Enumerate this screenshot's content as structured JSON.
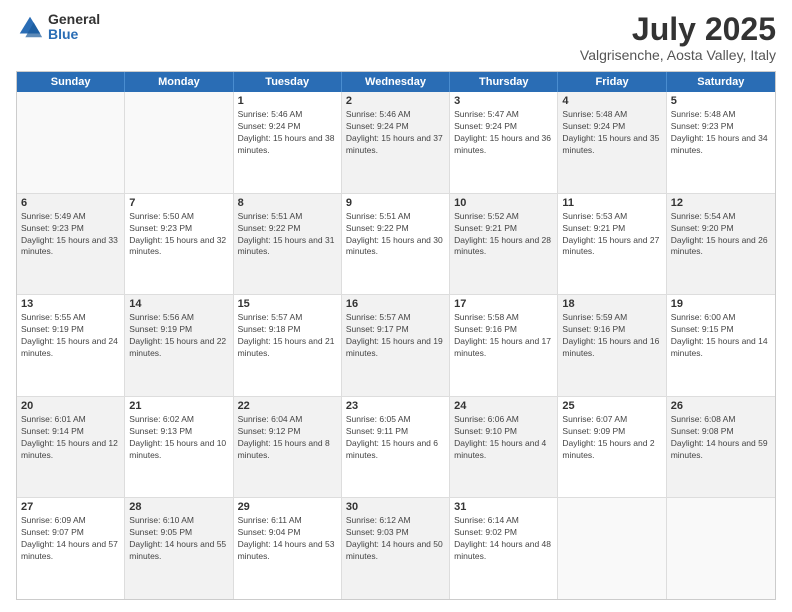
{
  "logo": {
    "general": "General",
    "blue": "Blue"
  },
  "title": "July 2025",
  "subtitle": "Valgrisenche, Aosta Valley, Italy",
  "days": [
    "Sunday",
    "Monday",
    "Tuesday",
    "Wednesday",
    "Thursday",
    "Friday",
    "Saturday"
  ],
  "weeks": [
    [
      {
        "day": "",
        "sunrise": "",
        "sunset": "",
        "daylight": "",
        "shaded": false,
        "empty": true
      },
      {
        "day": "",
        "sunrise": "",
        "sunset": "",
        "daylight": "",
        "shaded": false,
        "empty": true
      },
      {
        "day": "1",
        "sunrise": "Sunrise: 5:46 AM",
        "sunset": "Sunset: 9:24 PM",
        "daylight": "Daylight: 15 hours and 38 minutes.",
        "shaded": false,
        "empty": false
      },
      {
        "day": "2",
        "sunrise": "Sunrise: 5:46 AM",
        "sunset": "Sunset: 9:24 PM",
        "daylight": "Daylight: 15 hours and 37 minutes.",
        "shaded": true,
        "empty": false
      },
      {
        "day": "3",
        "sunrise": "Sunrise: 5:47 AM",
        "sunset": "Sunset: 9:24 PM",
        "daylight": "Daylight: 15 hours and 36 minutes.",
        "shaded": false,
        "empty": false
      },
      {
        "day": "4",
        "sunrise": "Sunrise: 5:48 AM",
        "sunset": "Sunset: 9:24 PM",
        "daylight": "Daylight: 15 hours and 35 minutes.",
        "shaded": true,
        "empty": false
      },
      {
        "day": "5",
        "sunrise": "Sunrise: 5:48 AM",
        "sunset": "Sunset: 9:23 PM",
        "daylight": "Daylight: 15 hours and 34 minutes.",
        "shaded": false,
        "empty": false
      }
    ],
    [
      {
        "day": "6",
        "sunrise": "Sunrise: 5:49 AM",
        "sunset": "Sunset: 9:23 PM",
        "daylight": "Daylight: 15 hours and 33 minutes.",
        "shaded": true,
        "empty": false
      },
      {
        "day": "7",
        "sunrise": "Sunrise: 5:50 AM",
        "sunset": "Sunset: 9:23 PM",
        "daylight": "Daylight: 15 hours and 32 minutes.",
        "shaded": false,
        "empty": false
      },
      {
        "day": "8",
        "sunrise": "Sunrise: 5:51 AM",
        "sunset": "Sunset: 9:22 PM",
        "daylight": "Daylight: 15 hours and 31 minutes.",
        "shaded": true,
        "empty": false
      },
      {
        "day": "9",
        "sunrise": "Sunrise: 5:51 AM",
        "sunset": "Sunset: 9:22 PM",
        "daylight": "Daylight: 15 hours and 30 minutes.",
        "shaded": false,
        "empty": false
      },
      {
        "day": "10",
        "sunrise": "Sunrise: 5:52 AM",
        "sunset": "Sunset: 9:21 PM",
        "daylight": "Daylight: 15 hours and 28 minutes.",
        "shaded": true,
        "empty": false
      },
      {
        "day": "11",
        "sunrise": "Sunrise: 5:53 AM",
        "sunset": "Sunset: 9:21 PM",
        "daylight": "Daylight: 15 hours and 27 minutes.",
        "shaded": false,
        "empty": false
      },
      {
        "day": "12",
        "sunrise": "Sunrise: 5:54 AM",
        "sunset": "Sunset: 9:20 PM",
        "daylight": "Daylight: 15 hours and 26 minutes.",
        "shaded": true,
        "empty": false
      }
    ],
    [
      {
        "day": "13",
        "sunrise": "Sunrise: 5:55 AM",
        "sunset": "Sunset: 9:19 PM",
        "daylight": "Daylight: 15 hours and 24 minutes.",
        "shaded": false,
        "empty": false
      },
      {
        "day": "14",
        "sunrise": "Sunrise: 5:56 AM",
        "sunset": "Sunset: 9:19 PM",
        "daylight": "Daylight: 15 hours and 22 minutes.",
        "shaded": true,
        "empty": false
      },
      {
        "day": "15",
        "sunrise": "Sunrise: 5:57 AM",
        "sunset": "Sunset: 9:18 PM",
        "daylight": "Daylight: 15 hours and 21 minutes.",
        "shaded": false,
        "empty": false
      },
      {
        "day": "16",
        "sunrise": "Sunrise: 5:57 AM",
        "sunset": "Sunset: 9:17 PM",
        "daylight": "Daylight: 15 hours and 19 minutes.",
        "shaded": true,
        "empty": false
      },
      {
        "day": "17",
        "sunrise": "Sunrise: 5:58 AM",
        "sunset": "Sunset: 9:16 PM",
        "daylight": "Daylight: 15 hours and 17 minutes.",
        "shaded": false,
        "empty": false
      },
      {
        "day": "18",
        "sunrise": "Sunrise: 5:59 AM",
        "sunset": "Sunset: 9:16 PM",
        "daylight": "Daylight: 15 hours and 16 minutes.",
        "shaded": true,
        "empty": false
      },
      {
        "day": "19",
        "sunrise": "Sunrise: 6:00 AM",
        "sunset": "Sunset: 9:15 PM",
        "daylight": "Daylight: 15 hours and 14 minutes.",
        "shaded": false,
        "empty": false
      }
    ],
    [
      {
        "day": "20",
        "sunrise": "Sunrise: 6:01 AM",
        "sunset": "Sunset: 9:14 PM",
        "daylight": "Daylight: 15 hours and 12 minutes.",
        "shaded": true,
        "empty": false
      },
      {
        "day": "21",
        "sunrise": "Sunrise: 6:02 AM",
        "sunset": "Sunset: 9:13 PM",
        "daylight": "Daylight: 15 hours and 10 minutes.",
        "shaded": false,
        "empty": false
      },
      {
        "day": "22",
        "sunrise": "Sunrise: 6:04 AM",
        "sunset": "Sunset: 9:12 PM",
        "daylight": "Daylight: 15 hours and 8 minutes.",
        "shaded": true,
        "empty": false
      },
      {
        "day": "23",
        "sunrise": "Sunrise: 6:05 AM",
        "sunset": "Sunset: 9:11 PM",
        "daylight": "Daylight: 15 hours and 6 minutes.",
        "shaded": false,
        "empty": false
      },
      {
        "day": "24",
        "sunrise": "Sunrise: 6:06 AM",
        "sunset": "Sunset: 9:10 PM",
        "daylight": "Daylight: 15 hours and 4 minutes.",
        "shaded": true,
        "empty": false
      },
      {
        "day": "25",
        "sunrise": "Sunrise: 6:07 AM",
        "sunset": "Sunset: 9:09 PM",
        "daylight": "Daylight: 15 hours and 2 minutes.",
        "shaded": false,
        "empty": false
      },
      {
        "day": "26",
        "sunrise": "Sunrise: 6:08 AM",
        "sunset": "Sunset: 9:08 PM",
        "daylight": "Daylight: 14 hours and 59 minutes.",
        "shaded": true,
        "empty": false
      }
    ],
    [
      {
        "day": "27",
        "sunrise": "Sunrise: 6:09 AM",
        "sunset": "Sunset: 9:07 PM",
        "daylight": "Daylight: 14 hours and 57 minutes.",
        "shaded": false,
        "empty": false
      },
      {
        "day": "28",
        "sunrise": "Sunrise: 6:10 AM",
        "sunset": "Sunset: 9:05 PM",
        "daylight": "Daylight: 14 hours and 55 minutes.",
        "shaded": true,
        "empty": false
      },
      {
        "day": "29",
        "sunrise": "Sunrise: 6:11 AM",
        "sunset": "Sunset: 9:04 PM",
        "daylight": "Daylight: 14 hours and 53 minutes.",
        "shaded": false,
        "empty": false
      },
      {
        "day": "30",
        "sunrise": "Sunrise: 6:12 AM",
        "sunset": "Sunset: 9:03 PM",
        "daylight": "Daylight: 14 hours and 50 minutes.",
        "shaded": true,
        "empty": false
      },
      {
        "day": "31",
        "sunrise": "Sunrise: 6:14 AM",
        "sunset": "Sunset: 9:02 PM",
        "daylight": "Daylight: 14 hours and 48 minutes.",
        "shaded": false,
        "empty": false
      },
      {
        "day": "",
        "sunrise": "",
        "sunset": "",
        "daylight": "",
        "shaded": true,
        "empty": true
      },
      {
        "day": "",
        "sunrise": "",
        "sunset": "",
        "daylight": "",
        "shaded": false,
        "empty": true
      }
    ]
  ]
}
